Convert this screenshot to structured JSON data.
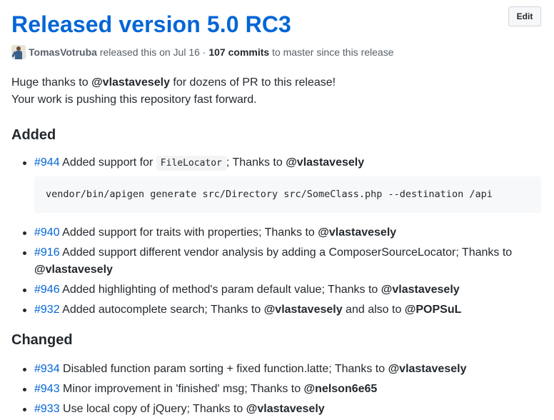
{
  "release": {
    "title": "Released version 5.0 RC3",
    "edit_label": "Edit",
    "author": "TomasVotruba",
    "meta_text": " released this on Jul 16 · ",
    "commits": "107 commits",
    "commits_suffix": " to master since this release"
  },
  "intro": {
    "line1_prefix": "Huge thanks to ",
    "mention": "@vlastavesely",
    "line1_suffix": " for dozens of PR to this release!",
    "line2": "Your work is pushing this repository fast forward."
  },
  "added": {
    "heading": "Added",
    "items": [
      {
        "pr": "#944",
        "text_before": " Added support for ",
        "code": "FileLocator",
        "text_after": "; Thanks to ",
        "mention": "@vlastavesely",
        "codeblock": "vendor/bin/apigen generate src/Directory src/SomeClass.php --destination /api"
      },
      {
        "pr": "#940",
        "text": " Added support for traits with properties; Thanks to ",
        "mention": "@vlastavesely"
      },
      {
        "pr": "#916",
        "text": " Added support different vendor analysis by adding a ComposerSourceLocator; Thanks to ",
        "mention": "@vlastavesely"
      },
      {
        "pr": "#946",
        "text": " Added highlighting of method's param default value; Thanks to ",
        "mention": "@vlastavesely"
      },
      {
        "pr": "#932",
        "text": " Added autocomplete search; Thanks to ",
        "mention": "@vlastavesely",
        "text2": " and also to ",
        "mention2": "@POPSuL"
      }
    ]
  },
  "changed": {
    "heading": "Changed",
    "items": [
      {
        "pr": "#934",
        "text": " Disabled function param sorting + fixed function.latte; Thanks to ",
        "mention": "@vlastavesely"
      },
      {
        "pr": "#943",
        "text": " Minor improvement in 'finished' msg; Thanks to ",
        "mention": "@nelson6e65"
      },
      {
        "pr": "#933",
        "text": " Use local copy of jQuery; Thanks to ",
        "mention": "@vlastavesely"
      }
    ]
  }
}
